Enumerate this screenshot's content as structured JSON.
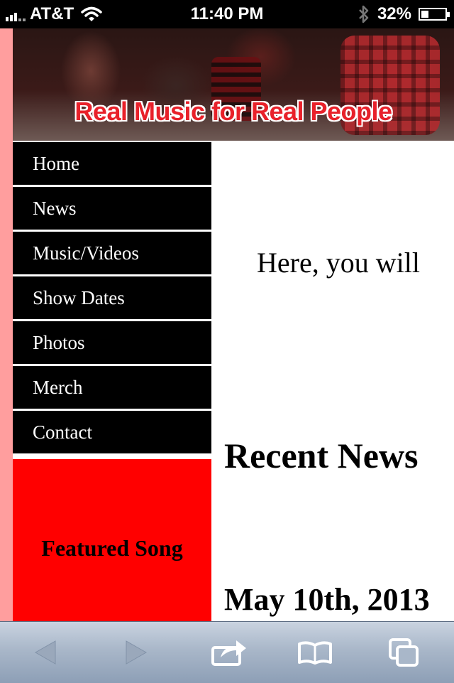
{
  "status_bar": {
    "carrier": "AT&T",
    "time": "11:40 PM",
    "battery_percent": "32%",
    "battery_level": 0.32,
    "icons": [
      "signal-icon",
      "wifi-icon",
      "bluetooth-icon",
      "battery-icon"
    ]
  },
  "banner": {
    "tagline": "Real Music for Real People"
  },
  "nav": {
    "items": [
      {
        "label": "Home"
      },
      {
        "label": "News"
      },
      {
        "label": "Music/Videos"
      },
      {
        "label": "Show Dates"
      },
      {
        "label": "Photos"
      },
      {
        "label": "Merch"
      },
      {
        "label": "Contact"
      }
    ]
  },
  "featured": {
    "title": "Featured Song"
  },
  "main": {
    "intro": "Here, you will",
    "recent_news_heading": "Recent News",
    "news_date": "May 10th, 2013"
  },
  "toolbar": {
    "buttons": [
      "back-icon",
      "forward-icon",
      "share-icon",
      "bookmarks-icon",
      "tabs-icon"
    ]
  },
  "colors": {
    "accent_red": "#ff0000",
    "nav_bg": "#000000",
    "side_strip": "#ff9e9e",
    "tagline_red": "#e8212a"
  }
}
